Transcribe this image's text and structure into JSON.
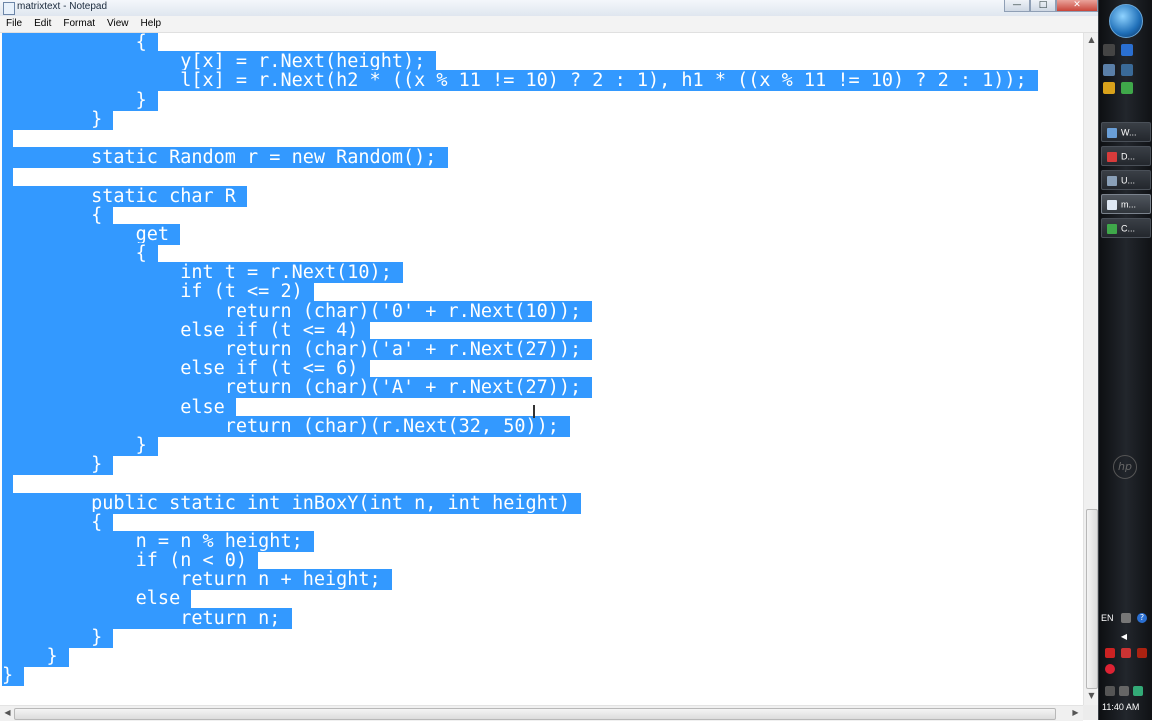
{
  "window": {
    "title": "matrixtext - Notepad",
    "min_glyph": "—",
    "max_glyph": "□",
    "close_glyph": "✕"
  },
  "menu": [
    "File",
    "Edit",
    "Format",
    "View",
    "Help"
  ],
  "editor": {
    "lines": [
      "            {",
      "                y[x] = r.Next(height);",
      "                l[x] = r.Next(h2 * ((x % 11 != 10) ? 2 : 1), h1 * ((x % 11 != 10) ? 2 : 1));",
      "            }",
      "        }",
      "",
      "        static Random r = new Random();",
      "",
      "        static char R",
      "        {",
      "            get",
      "            {",
      "                int t = r.Next(10);",
      "                if (t <= 2)",
      "                    return (char)('0' + r.Next(10));",
      "                else if (t <= 4)",
      "                    return (char)('a' + r.Next(27));",
      "                else if (t <= 6)",
      "                    return (char)('A' + r.Next(27));",
      "                else",
      "                    return (char)(r.Next(32, 50));",
      "            }",
      "        }",
      "",
      "        public static int inBoxY(int n, int height)",
      "        {",
      "            n = n % height;",
      "            if (n < 0)",
      "                return n + height;",
      "            else",
      "                return n;",
      "        }",
      "    }",
      "}"
    ],
    "selection_color": "#3399ff"
  },
  "scrollbar": {
    "up": "▲",
    "down": "▼",
    "left": "◀",
    "right": "▶"
  },
  "taskbar": {
    "items": [
      {
        "label": "W...",
        "color": "#6a9fd8"
      },
      {
        "label": "D...",
        "color": "#d83b3b"
      },
      {
        "label": "U...",
        "color": "#8aa0b8"
      },
      {
        "label": "m...",
        "color": "#dfe9f5"
      },
      {
        "label": "C...",
        "color": "#3fa84a"
      }
    ],
    "language": "EN",
    "clock": "11:40 AM",
    "oem_logo": "hp"
  }
}
